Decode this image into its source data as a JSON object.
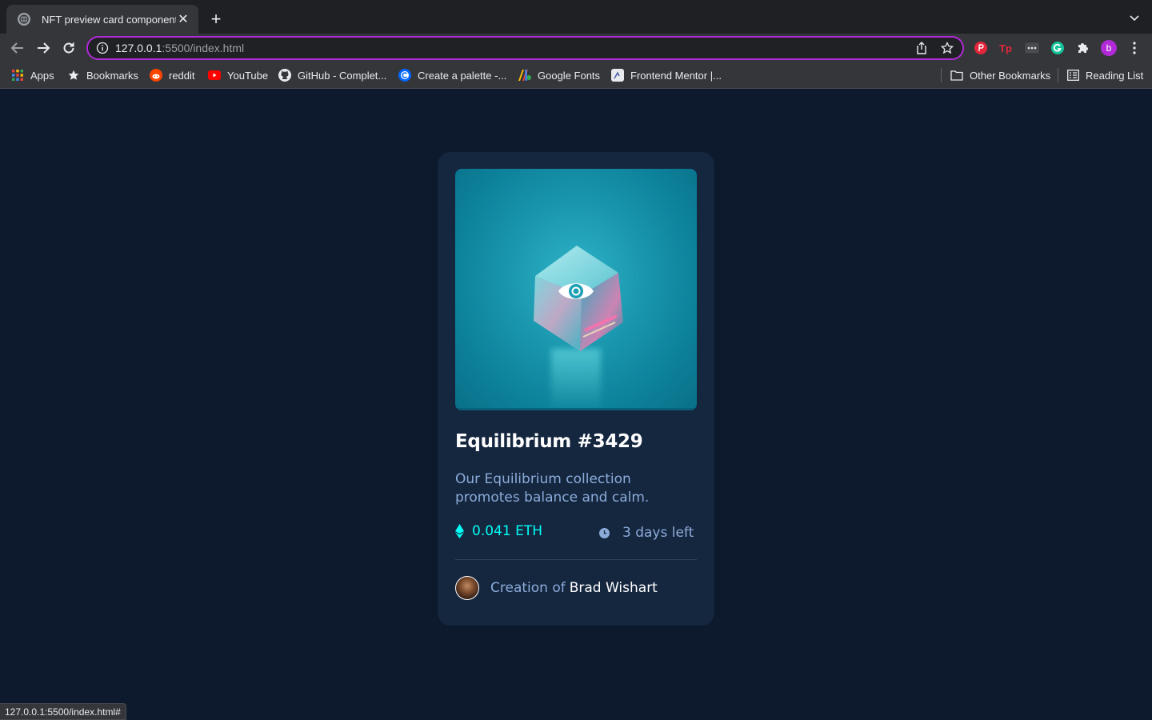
{
  "browser": {
    "tab_title": "NFT preview card component",
    "tab_close": "✕",
    "new_tab": "+",
    "url_host": "127.0.0.1",
    "url_rest": ":5500/index.html",
    "profile_initial": "b",
    "accent_color": "#b12ad8"
  },
  "bookmarks": [
    {
      "label": "Apps",
      "icon": "apps-grid-icon"
    },
    {
      "label": "Bookmarks",
      "icon": "star-icon"
    },
    {
      "label": "reddit",
      "icon": "reddit-icon"
    },
    {
      "label": "YouTube",
      "icon": "youtube-icon"
    },
    {
      "label": "GitHub - Complet...",
      "icon": "github-icon"
    },
    {
      "label": "Create a palette -...",
      "icon": "coolors-icon"
    },
    {
      "label": "Google Fonts",
      "icon": "google-fonts-icon"
    },
    {
      "label": "Frontend Mentor |...",
      "icon": "frontend-mentor-icon"
    },
    {
      "label": "Other Bookmarks",
      "icon": "folder-icon"
    },
    {
      "label": "Reading List",
      "icon": "reading-list-icon"
    }
  ],
  "card": {
    "title": "Equilibrium #3429",
    "description": "Our Equilibrium collection promotes balance and calm.",
    "price": "0.041 ETH",
    "time_left": "3 days left",
    "creation_prefix": "Creation of",
    "creator_name": "Brad Wishart",
    "colors": {
      "bg": "#0d192c",
      "card": "#15263f",
      "cyan": "#00fff8",
      "soft_blue": "#8bacd9"
    }
  },
  "status_bar": "127.0.0.1:5500/index.html#"
}
